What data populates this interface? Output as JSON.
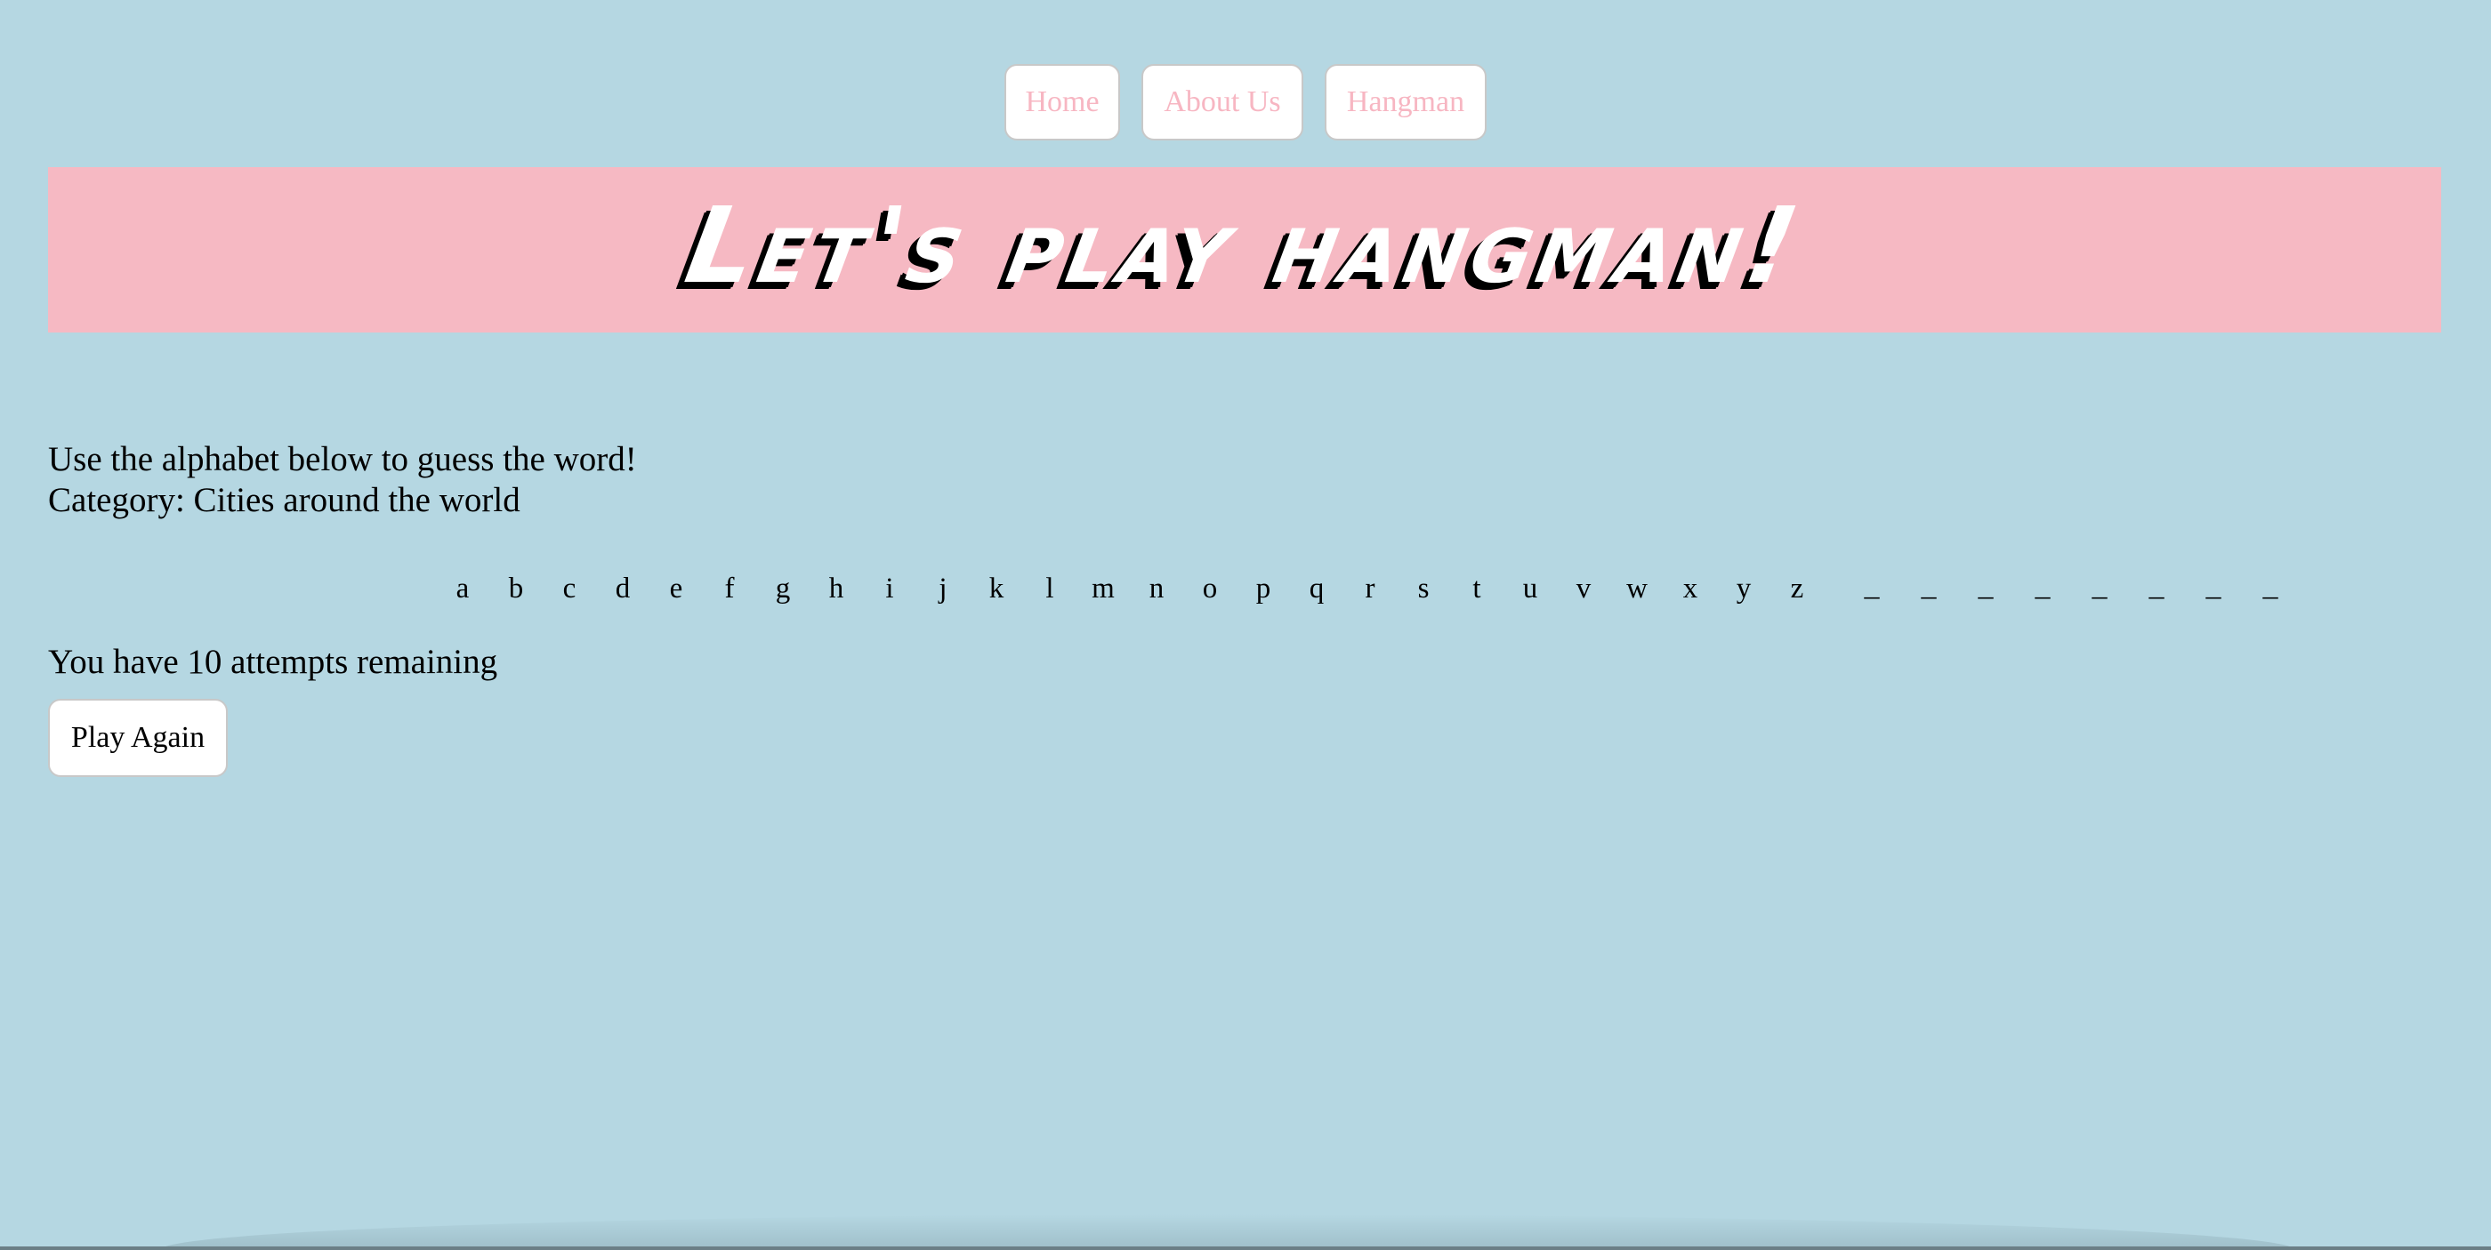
{
  "nav": {
    "items": [
      {
        "label": "Home"
      },
      {
        "label": "About Us"
      },
      {
        "label": "Hangman"
      }
    ]
  },
  "banner": {
    "title": "Let's play hangman!"
  },
  "instructions": {
    "line1": "Use the alphabet below to guess the word!",
    "line2": "Category: Cities around the world"
  },
  "alphabet": [
    "a",
    "b",
    "c",
    "d",
    "e",
    "f",
    "g",
    "h",
    "i",
    "j",
    "k",
    "l",
    "m",
    "n",
    "o",
    "p",
    "q",
    "r",
    "s",
    "t",
    "u",
    "v",
    "w",
    "x",
    "y",
    "z"
  ],
  "word": {
    "blanks": [
      "_",
      "_",
      "_",
      "_",
      "_",
      "_",
      "_",
      "_"
    ]
  },
  "status": {
    "attempts": "You have 10 attempts remaining"
  },
  "actions": {
    "play_again": "Play Again"
  },
  "colors": {
    "background": "#b5d7e2",
    "banner": "#f6b9c3",
    "nav_text": "#f7b6c2"
  }
}
